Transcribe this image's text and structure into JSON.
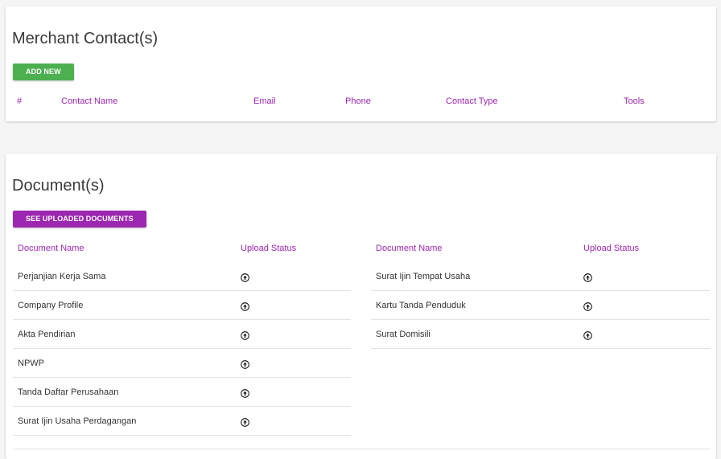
{
  "contacts": {
    "title": "Merchant Contact(s)",
    "add_button": "ADD NEW",
    "columns": [
      "#",
      "Contact Name",
      "Email",
      "Phone",
      "Contact Type",
      "Tools"
    ]
  },
  "documents": {
    "title": "Document(s)",
    "see_button": "SEE UPLOADED DOCUMENTS",
    "left_headers": {
      "name": "Document Name",
      "status": "Upload Status"
    },
    "right_headers": {
      "name": "Document Name",
      "status": "Upload Status"
    },
    "left_rows": [
      {
        "name": "Perjanjian Kerja Sama",
        "status_icon": "upload-icon"
      },
      {
        "name": "Company Profile",
        "status_icon": "upload-icon"
      },
      {
        "name": "Akta Pendirian",
        "status_icon": "upload-icon"
      },
      {
        "name": "NPWP",
        "status_icon": "upload-icon"
      },
      {
        "name": "Tanda Daftar Perusahaan",
        "status_icon": "upload-icon"
      },
      {
        "name": "Surat Ijin Usaha Perdagangan",
        "status_icon": "upload-icon"
      }
    ],
    "right_rows": [
      {
        "name": "Surat Ijin Tempat Usaha",
        "status_icon": "upload-icon"
      },
      {
        "name": "Kartu Tanda Penduduk",
        "status_icon": "upload-icon"
      },
      {
        "name": "Surat Domisili",
        "status_icon": "upload-icon"
      }
    ]
  },
  "colors": {
    "accent": "#9c27b0",
    "success": "#4caf50"
  }
}
